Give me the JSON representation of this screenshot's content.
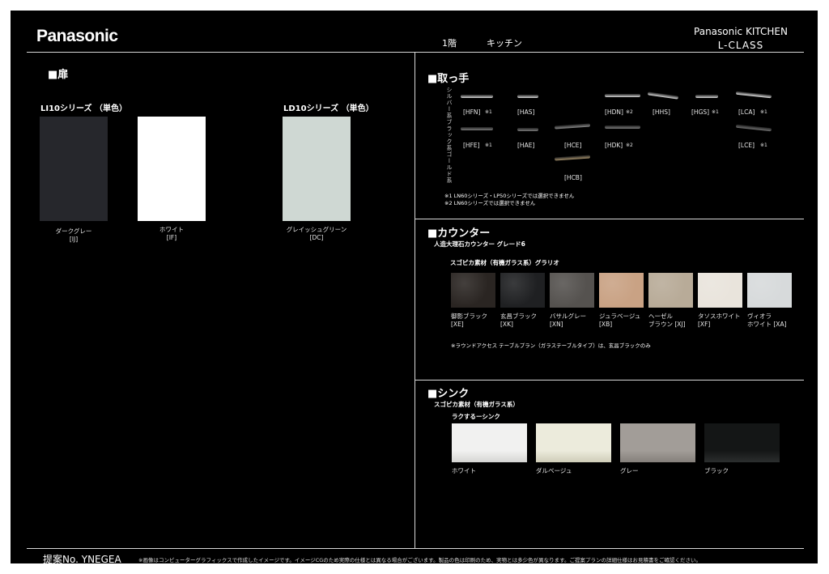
{
  "header": {
    "brand": "Panasonic",
    "floor": "1階",
    "room": "キッチン",
    "series_name": "Panasonic KITCHEN",
    "series_sub": "L-CLASS"
  },
  "door": {
    "section_title": "■扉",
    "groups": [
      {
        "label": "LI10シリーズ （単色）",
        "swatches": [
          {
            "name": "ダークグレー",
            "code": "[IJ]",
            "color": "#26272c"
          },
          {
            "name": "ホワイト",
            "code": "[IF]",
            "color": "#ffffff"
          }
        ]
      },
      {
        "label": "LD10シリーズ （単色）",
        "swatches": [
          {
            "name": "グレイッシュグリーン",
            "code": "[DC]",
            "color": "#cfd8d3"
          }
        ]
      }
    ]
  },
  "handles": {
    "section_title": "■取っ手",
    "row_labels": [
      "シルバー系",
      "ブラック系",
      "ゴールド系"
    ],
    "silver": [
      {
        "code": "[HFN]",
        "note": "※1",
        "color": "#d9d9d9"
      },
      {
        "code": "[HAS]",
        "note": "",
        "color": "#d9d9d9"
      },
      {
        "code": "[HDN]",
        "note": "※2",
        "color": "#d9d9d9"
      },
      {
        "code": "[HHS]",
        "note": "",
        "color": "#d9d9d9"
      },
      {
        "code": "[HGS]",
        "note": "※1",
        "color": "#d9d9d9"
      },
      {
        "code": "[LCA]",
        "note": "※1",
        "color": "#e3e3e3"
      }
    ],
    "black": [
      {
        "code": "[HFE]",
        "note": "※1",
        "color": "#7a7a7a"
      },
      {
        "code": "[HAE]",
        "note": "",
        "color": "#7a7a7a"
      },
      {
        "code": "[HCE]",
        "note": "",
        "color": "#8a8a8a"
      },
      {
        "code": "[HDK]",
        "note": "※2",
        "color": "#7a7a7a"
      },
      {
        "code": "[LCE]",
        "note": "※1",
        "color": "#6e6e6e"
      }
    ],
    "gold": [
      {
        "code": "[HCB]",
        "note": "",
        "color": "#a48f6a"
      }
    ],
    "notes": [
      "※1 LN60シリーズ・LP50シリーズでは選択できません",
      "※2 LN60シリーズでは選択できません"
    ]
  },
  "counter": {
    "section_title": "■カウンター",
    "subtitle": "人造大理石カウンター グレード6",
    "material": "スゴピカ素材（有機ガラス系）グラリオ",
    "swatches": [
      {
        "label": "御影ブラック\n[XE]",
        "color": "#2a2522"
      },
      {
        "label": "玄昌ブラック\n[XK]",
        "color": "#1f2022"
      },
      {
        "label": "バサルグレー\n[XN]",
        "color": "#55524f"
      },
      {
        "label": "ジュラベージュ\n[XB]",
        "color": "#c9a284"
      },
      {
        "label": "ヘーゼル\nブラウン [XJ]",
        "color": "#b8ab98"
      },
      {
        "label": "タソスホワイト\n[XF]",
        "color": "#e9e4dc"
      },
      {
        "label": "ヴィオラ\nホワイト [XA]",
        "color": "#d7dadb"
      }
    ],
    "note": "※ラウンドアクセス テーブルプラン（ガラステーブルタイプ）は、玄昌ブラックのみ"
  },
  "sink": {
    "section_title": "■シンク",
    "material": "スゴピカ素材（有機ガラス系）",
    "type": "ラクするーシンク",
    "swatches": [
      {
        "label": "ホワイト",
        "color": "#f1f1f0",
        "edge": "#d5d5d3"
      },
      {
        "label": "ダルベージュ",
        "color": "#ecebdc",
        "edge": "#cfcdb8"
      },
      {
        "label": "グレー",
        "color": "#a29d98",
        "edge": "#85807b"
      },
      {
        "label": "ブラック",
        "color": "#141616",
        "edge": "#2b2e2e"
      }
    ]
  },
  "footer": {
    "proposal_no": "提案No. YNEGEA",
    "disclaimer": "※画像はコンピューターグラフィックスで作成したイメージです。イメージCGのため実際の仕様とは異なる場合がございます。製品の色は印刷のため、実物とは多少色が異なります。ご提案プランの詳細仕様はお見積書をご確認ください。"
  }
}
